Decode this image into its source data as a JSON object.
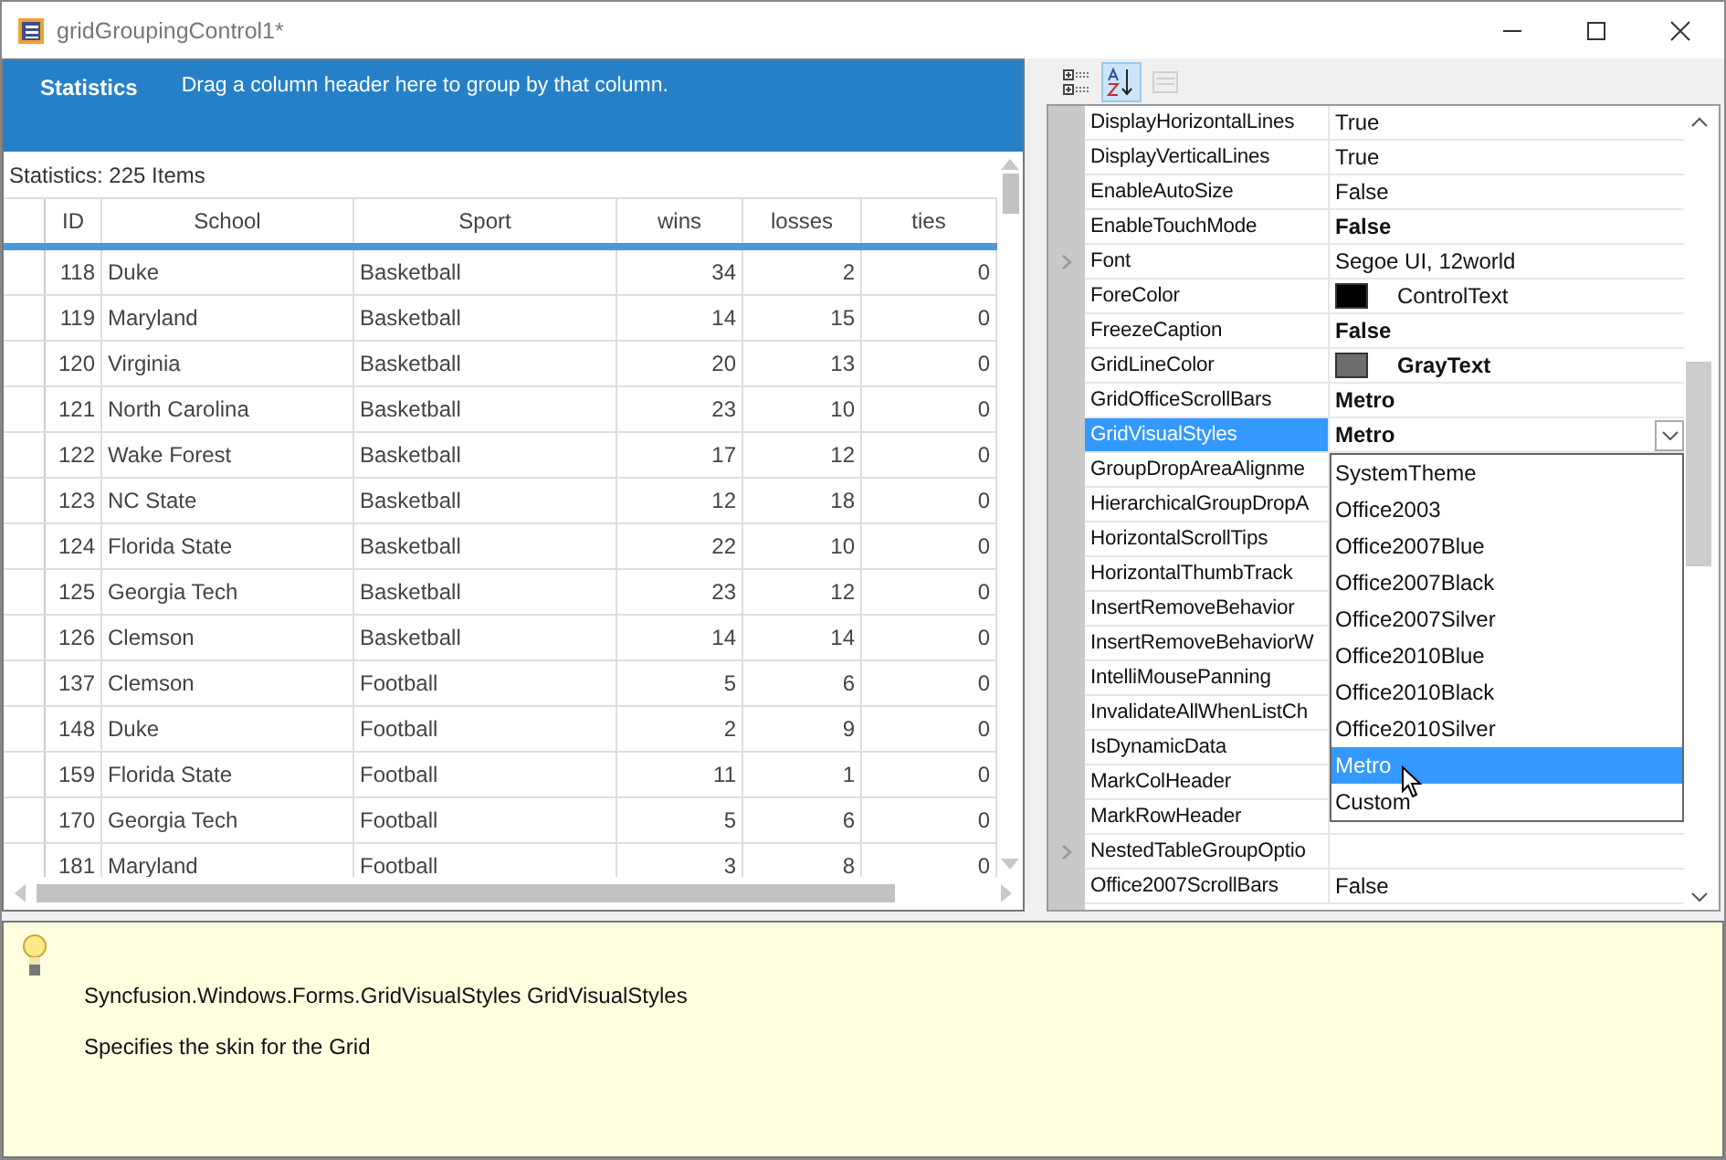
{
  "window": {
    "title": "gridGroupingControl1*"
  },
  "grid": {
    "caption": {
      "title": "Statistics",
      "hint": "Drag a column header here to group by that column."
    },
    "statistics": "Statistics: 225 Items",
    "columns": [
      {
        "label": "ID"
      },
      {
        "label": "School"
      },
      {
        "label": "Sport"
      },
      {
        "label": "wins"
      },
      {
        "label": "losses"
      },
      {
        "label": "ties"
      }
    ],
    "rows": [
      [
        "118",
        "Duke",
        "Basketball",
        "34",
        "2",
        "0"
      ],
      [
        "119",
        "Maryland",
        "Basketball",
        "14",
        "15",
        "0"
      ],
      [
        "120",
        "Virginia",
        "Basketball",
        "20",
        "13",
        "0"
      ],
      [
        "121",
        "North Carolina",
        "Basketball",
        "23",
        "10",
        "0"
      ],
      [
        "122",
        "Wake Forest",
        "Basketball",
        "17",
        "12",
        "0"
      ],
      [
        "123",
        "NC State",
        "Basketball",
        "12",
        "18",
        "0"
      ],
      [
        "124",
        "Florida State",
        "Basketball",
        "22",
        "10",
        "0"
      ],
      [
        "125",
        "Georgia Tech",
        "Basketball",
        "23",
        "12",
        "0"
      ],
      [
        "126",
        "Clemson",
        "Basketball",
        "14",
        "14",
        "0"
      ],
      [
        "137",
        "Clemson",
        "Football",
        "5",
        "6",
        "0"
      ],
      [
        "148",
        "Duke",
        "Football",
        "2",
        "9",
        "0"
      ],
      [
        "159",
        "Florida State",
        "Football",
        "11",
        "1",
        "0"
      ],
      [
        "170",
        "Georgia Tech",
        "Football",
        "5",
        "6",
        "0"
      ],
      [
        "181",
        "Maryland",
        "Football",
        "3",
        "8",
        "0"
      ]
    ]
  },
  "property_grid": {
    "toolbar": [
      {
        "kind": "categorized",
        "selected": false,
        "disabled": false
      },
      {
        "kind": "alphabetical",
        "selected": true,
        "disabled": false
      },
      {
        "kind": "property-pages",
        "selected": false,
        "disabled": true
      }
    ],
    "properties": [
      {
        "name": "DisplayHorizontalLines",
        "value": "True",
        "bold": false,
        "expandable": false,
        "selected": false
      },
      {
        "name": "DisplayVerticalLines",
        "value": "True",
        "bold": false,
        "expandable": false,
        "selected": false
      },
      {
        "name": "EnableAutoSize",
        "value": "False",
        "bold": false,
        "expandable": false,
        "selected": false
      },
      {
        "name": "EnableTouchMode",
        "value": "False",
        "bold": true,
        "expandable": false,
        "selected": false
      },
      {
        "name": "Font",
        "value": "Segoe UI, 12world",
        "bold": false,
        "expandable": true,
        "selected": false
      },
      {
        "name": "ForeColor",
        "value": "ControlText",
        "bold": false,
        "expandable": false,
        "selected": false,
        "color": "#000000"
      },
      {
        "name": "FreezeCaption",
        "value": "False",
        "bold": true,
        "expandable": false,
        "selected": false
      },
      {
        "name": "GridLineColor",
        "value": "GrayText",
        "bold": true,
        "expandable": false,
        "selected": false,
        "color": "#6d6d6d"
      },
      {
        "name": "GridOfficeScrollBars",
        "value": "Metro",
        "bold": true,
        "expandable": false,
        "selected": false
      },
      {
        "name": "GridVisualStyles",
        "value": "Metro",
        "bold": true,
        "expandable": false,
        "selected": true,
        "dropdown": true
      },
      {
        "name": "GroupDropAreaAlignme",
        "expandable": false,
        "selected": false
      },
      {
        "name": "HierarchicalGroupDropA",
        "expandable": false,
        "selected": false
      },
      {
        "name": "HorizontalScrollTips",
        "expandable": false,
        "selected": false
      },
      {
        "name": "HorizontalThumbTrack",
        "expandable": false,
        "selected": false
      },
      {
        "name": "InsertRemoveBehavior",
        "expandable": false,
        "selected": false
      },
      {
        "name": "InsertRemoveBehaviorW",
        "expandable": false,
        "selected": false
      },
      {
        "name": "IntelliMousePanning",
        "expandable": false,
        "selected": false
      },
      {
        "name": "InvalidateAllWhenListCh",
        "expandable": false,
        "selected": false
      },
      {
        "name": "IsDynamicData",
        "expandable": false,
        "selected": false
      },
      {
        "name": "MarkColHeader",
        "expandable": false,
        "selected": false
      },
      {
        "name": "MarkRowHeader",
        "expandable": false,
        "selected": false
      },
      {
        "name": "NestedTableGroupOptio",
        "expandable": true,
        "selected": false
      },
      {
        "name": "Office2007ScrollBars",
        "value": "False",
        "bold": false,
        "expandable": false,
        "selected": false
      }
    ],
    "dropdown": {
      "options": [
        {
          "label": "SystemTheme",
          "selected": false
        },
        {
          "label": "Office2003",
          "selected": false
        },
        {
          "label": "Office2007Blue",
          "selected": false
        },
        {
          "label": "Office2007Black",
          "selected": false
        },
        {
          "label": "Office2007Silver",
          "selected": false
        },
        {
          "label": "Office2010Blue",
          "selected": false
        },
        {
          "label": "Office2010Black",
          "selected": false
        },
        {
          "label": "Office2010Silver",
          "selected": false
        },
        {
          "label": "Metro",
          "selected": true
        },
        {
          "label": "Custom",
          "selected": false
        }
      ]
    }
  },
  "description": {
    "title": "Syncfusion.Windows.Forms.GridVisualStyles GridVisualStyles",
    "text": "Specifies the skin for the Grid"
  }
}
